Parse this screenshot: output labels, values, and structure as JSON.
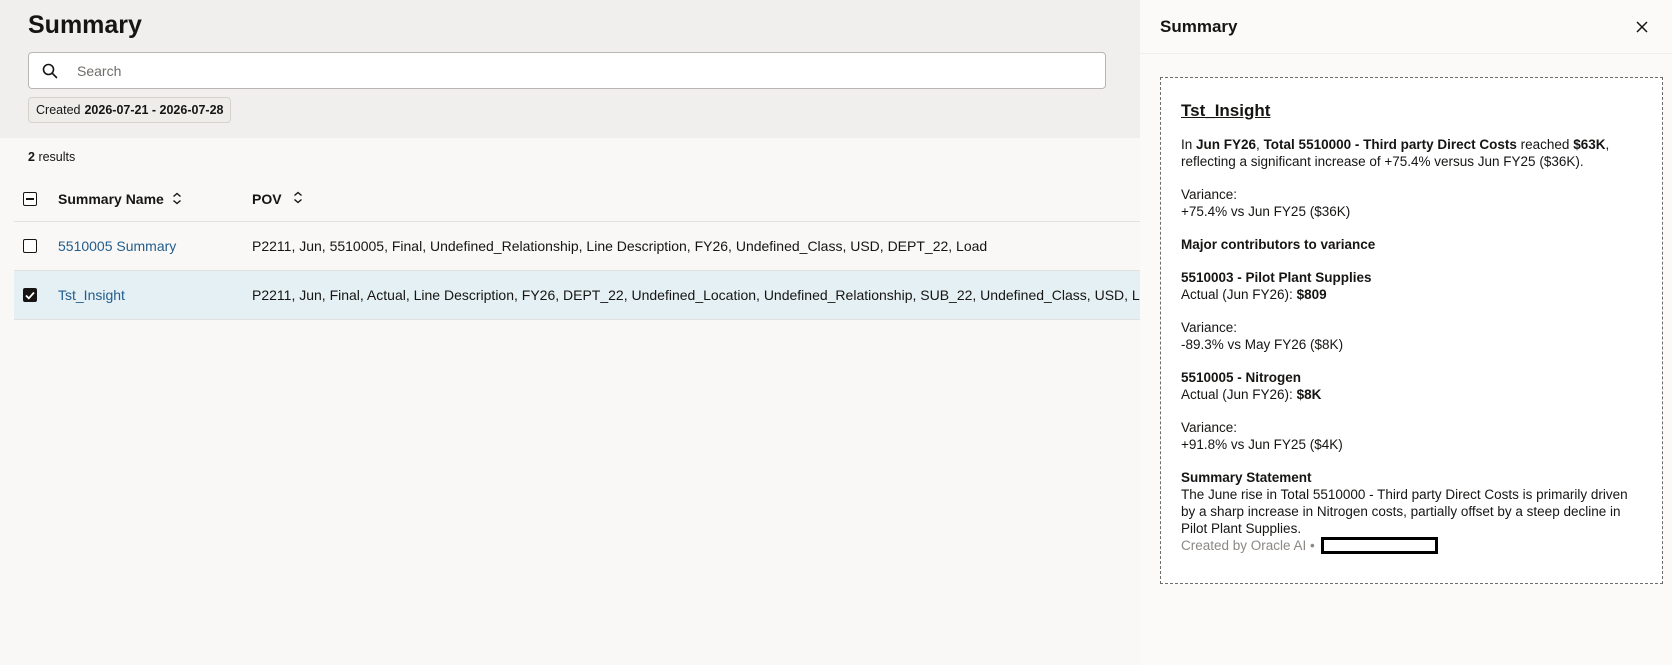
{
  "page": {
    "title": "Summary"
  },
  "search": {
    "placeholder": "Search"
  },
  "filter": {
    "label": "Created",
    "value": "2026-07-21 - 2026-07-28"
  },
  "results": {
    "count": "2",
    "suffix": "results"
  },
  "table": {
    "columns": [
      "Summary Name",
      "POV"
    ],
    "rows": [
      {
        "name": "5510005 Summary",
        "pov": "P2211, Jun, 5510005, Final, Undefined_Relationship, Line Description, FY26, Undefined_Class, USD, DEPT_22, Load",
        "selected": false
      },
      {
        "name": "Tst_Insight",
        "pov": "P2211, Jun, Final, Actual, Line Description, FY26, DEPT_22, Undefined_Location, Undefined_Relationship, SUB_22, Undefined_Class, USD, Load",
        "selected": true
      }
    ]
  },
  "drawer": {
    "title": "Summary",
    "insight": {
      "title": "Tst_Insight",
      "intro": {
        "p1": "In ",
        "period": "Jun FY26",
        "p2": ", ",
        "account": "Total 5510000 - Third party Direct Costs",
        "p3": " reached ",
        "amount": "$63K",
        "p4": ", reflecting a significant increase of +75.4% versus Jun FY25 ($36K)."
      },
      "variance_label": "Variance:",
      "variance_value": "+75.4% vs Jun FY25 ($36K)",
      "contributors_heading": "Major contributors to variance",
      "contributors": [
        {
          "name": "5510003 - Pilot Plant Supplies",
          "actual_label": "Actual (Jun FY26): ",
          "actual_value": "$809",
          "variance_label": "Variance:",
          "variance_value": "-89.3% vs May FY26 ($8K)"
        },
        {
          "name": "5510005 - Nitrogen",
          "actual_label": "Actual (Jun FY26): ",
          "actual_value": "$8K",
          "variance_label": "Variance:",
          "variance_value": "+91.8% vs Jun FY25 ($4K)"
        }
      ],
      "summary_heading": "Summary Statement",
      "summary_text": "The June rise in Total 5510000 - Third party Direct Costs is primarily driven by a sharp increase in Nitrogen costs, partially offset by a steep decline in Pilot Plant Supplies.",
      "footer": "Created by Oracle AI •"
    }
  },
  "colors": {
    "link": "#235d8c",
    "selected_row": "#e4f0f4",
    "header_bg": "#f1efed",
    "muted_text": "#8b8884"
  }
}
